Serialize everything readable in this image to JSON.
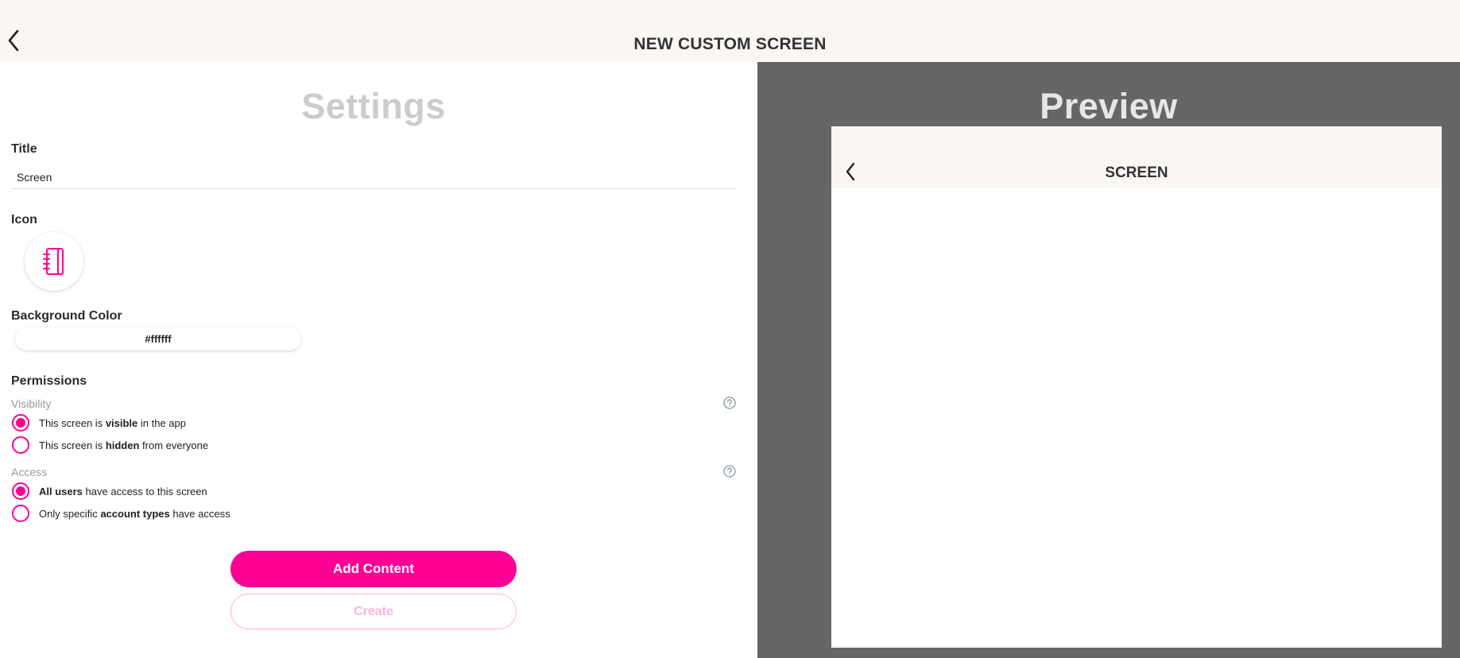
{
  "header": {
    "title": "NEW CUSTOM SCREEN",
    "back_icon": "chevron-left-icon"
  },
  "settings": {
    "heading": "Settings",
    "title_label": "Title",
    "title_value": "Screen",
    "icon_label": "Icon",
    "icon_name": "notebook-icon",
    "bg_color_label": "Background Color",
    "bg_color_value": "#ffffff",
    "permissions_label": "Permissions",
    "visibility": {
      "label": "Visibility",
      "options": [
        {
          "pre": "This screen is ",
          "bold": "visible",
          "post": " in the app",
          "selected": true
        },
        {
          "pre": "This screen is ",
          "bold": "hidden",
          "post": " from everyone",
          "selected": false
        }
      ]
    },
    "access": {
      "label": "Access",
      "options": [
        {
          "pre": "",
          "bold": "All users",
          "post": " have access to this screen",
          "selected": true
        },
        {
          "pre": "Only specific ",
          "bold": "account types",
          "post": " have access",
          "selected": false
        }
      ]
    },
    "add_content_label": "Add Content",
    "create_label": "Create"
  },
  "preview": {
    "heading": "Preview",
    "screen_title": "SCREEN"
  },
  "colors": {
    "accent": "#ff0095",
    "accent_light": "#ffb3da",
    "header_bg": "#f9f6f3",
    "preview_bg": "#666666",
    "help_icon": "#8a93ad"
  }
}
